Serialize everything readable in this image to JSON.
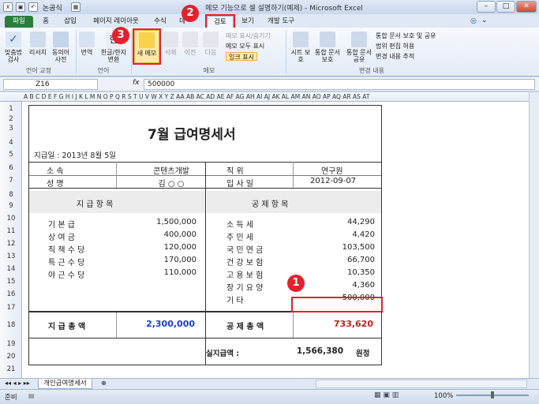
{
  "window": {
    "title": "메모 기능으로 셀 설명하기(예제) - Microsoft Excel"
  },
  "quick_access": {
    "search": "논공식"
  },
  "tabs": [
    "파일",
    "홈",
    "삽입",
    "페이지 레이아웃",
    "수식",
    "데",
    "검토",
    "보기",
    "개발 도구"
  ],
  "ribbon": {
    "spell": "맞춤법 검사",
    "research": "리서치",
    "thesaurus": "동의어 사전",
    "translate": "번역",
    "hanja": "한글/한자 변환",
    "new_memo": "새 메모",
    "delete": "삭제",
    "prev": "이전",
    "next": "다음",
    "show_hide": "메모 표시/숨기기",
    "show_all": "메모 모두 표시",
    "ink": "잉크 표시",
    "protect_sheet": "시트 보호",
    "protect_wb": "통합 문서 보호",
    "share_wb": "통합 문서 공유",
    "protect_share": "통합 문서 보호 및 공유",
    "allow_edit": "범위 편집 허용",
    "track": "변경 내용 추적",
    "group_lang_fix": "언어 교정",
    "group_lang": "언어",
    "group_memo": "메모",
    "group_changes": "변경 내용"
  },
  "formula_bar": {
    "name_box": "Z16",
    "fx": "fx",
    "value": "500000"
  },
  "column_headers": "A B C D E F G H I J K L M N O P Q R S T U V W X Y Z AA AB AC AD AE AF AG AH AI AJ AK AL AM AN AO AP AQ AR AS AT",
  "rows": [
    "1",
    "2",
    "3",
    "4",
    "5",
    "6",
    "7",
    "8",
    "9",
    "10",
    "11",
    "12",
    "13",
    "14",
    "15",
    "16",
    "17",
    "18",
    "19",
    "20",
    "21"
  ],
  "sheet": {
    "title": "7월  급여명세서",
    "pay_date": "지급일 :  2013년 8월 5일",
    "dept_label": "소       속",
    "dept": "콘텐츠개발",
    "pos_label": "직       위",
    "pos": "연구원",
    "name_label": "성       명",
    "name": "김 ○ ○",
    "join_label": "입  사  일",
    "join": "2012-09-07",
    "pay_header": "지    급    항    목",
    "ded_header": "공    제    항    목",
    "pay_items": [
      {
        "label": "기    본    급",
        "value": "1,500,000"
      },
      {
        "label": "상    여    금",
        "value": "400,000"
      },
      {
        "label": "직  책  수  당",
        "value": "120,000"
      },
      {
        "label": "특  근  수  당",
        "value": "170,000"
      },
      {
        "label": "야  근  수  당",
        "value": "110,000"
      }
    ],
    "ded_items": [
      {
        "label": "소    득    세",
        "value": "44,290"
      },
      {
        "label": "주    민    세",
        "value": "4,420"
      },
      {
        "label": "국  민  연  금",
        "value": "103,500"
      },
      {
        "label": "건  강  보  험",
        "value": "66,700"
      },
      {
        "label": "고  용  보  험",
        "value": "10,350"
      },
      {
        "label": "장  기  요  양",
        "value": "4,360"
      },
      {
        "label": "기          타",
        "value": "500,000"
      }
    ],
    "pay_total_label": "지  급  총  액",
    "pay_total": "2,300,000",
    "ded_total_label": "공  제  총  액",
    "ded_total": "733,620",
    "net_label": "실지급액     :",
    "net": "1,566,380",
    "net_unit": "원정"
  },
  "sheet_tab": "개인급여명세서",
  "status": {
    "ready": "준비",
    "zoom": "100%"
  },
  "badges": [
    "1",
    "2",
    "3"
  ],
  "colors": {
    "file_tab": "#2a7e3b",
    "badge": "#e2222a",
    "pay_total": "#1a3cc9",
    "ded_total": "#d81818"
  }
}
